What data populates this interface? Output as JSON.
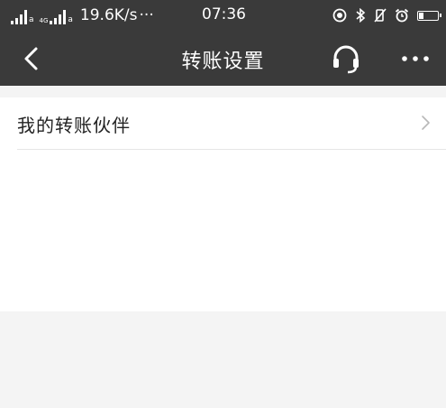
{
  "status_bar": {
    "sim1_tag": "a",
    "network_tag": "4G",
    "sim2_tag": "a",
    "net_speed": "19.6K/s",
    "more_dots": "···",
    "time": "07:36",
    "icons": [
      "location-icon",
      "bluetooth-icon",
      "vibrate-mute-icon",
      "alarm-icon",
      "battery-icon"
    ]
  },
  "nav": {
    "title": "转账设置",
    "back_icon": "chevron-left-icon",
    "service_icon": "headset-icon",
    "more_icon": "more-dots-icon"
  },
  "settings": {
    "items": [
      {
        "label": "我的转账伙伴",
        "icon": "chevron-right-icon"
      }
    ]
  },
  "colors": {
    "header_bg": "#3a3a3a",
    "page_bg": "#f4f4f4",
    "card_bg": "#ffffff"
  }
}
